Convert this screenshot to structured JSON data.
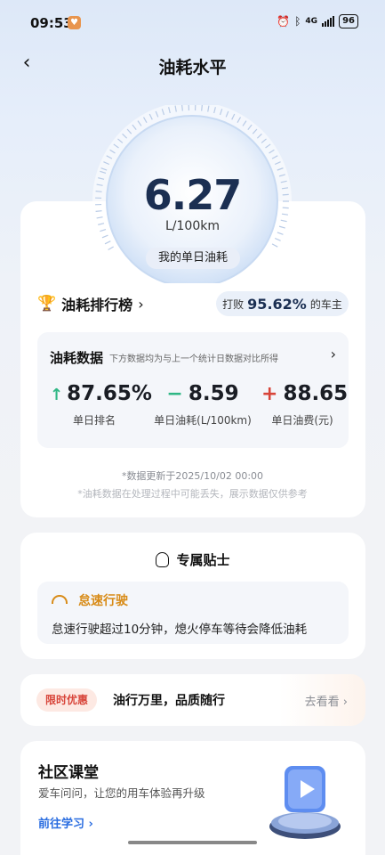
{
  "status_bar": {
    "time": "09:53",
    "network": "4G",
    "battery": "96"
  },
  "header": {
    "back_icon": "chevron-left-icon",
    "title": "油耗水平"
  },
  "gauge": {
    "value": "6.27",
    "unit": "L/100km",
    "label": "我的单日油耗"
  },
  "ranking": {
    "label": "油耗排行榜",
    "beat_prefix": "打败",
    "beat_value": "95.62%",
    "beat_suffix": "的车主"
  },
  "fuel_data": {
    "title": "油耗数据",
    "subtitle": "下方数据均为与上一个统计日数据对比所得",
    "metrics": [
      {
        "symbol": "↑",
        "value": "87.65%",
        "label": "单日排名",
        "trend": "up"
      },
      {
        "symbol": "−",
        "value": "8.59",
        "label": "单日油耗(L/100km)",
        "trend": "flat"
      },
      {
        "symbol": "+",
        "value": "88.65",
        "label": "单日油费(元)",
        "trend": "up-cost"
      }
    ]
  },
  "footnotes": {
    "updated": "*数据更新于2025/10/02 00:00",
    "disclaimer": "*油耗数据在处理过程中可能丢失，展示数据仅供参考"
  },
  "tips": {
    "title": "专属贴士",
    "item_title": "怠速行驶",
    "item_text": "怠速行驶超过10分钟，熄火停车等待会降低油耗"
  },
  "promo": {
    "tag": "限时优惠",
    "text": "油行万里，品质随行",
    "more": "去看看"
  },
  "community": {
    "title": "社区课堂",
    "subtitle": "爱车问问，让您的用车体验再升级",
    "link": "前往学习"
  },
  "colors": {
    "accent_blue": "#2a6de0",
    "gauge_value": "#1b2f52",
    "up_green": "#2fb785",
    "cost_red": "#d8453a",
    "tip_orange": "#d88b17"
  }
}
